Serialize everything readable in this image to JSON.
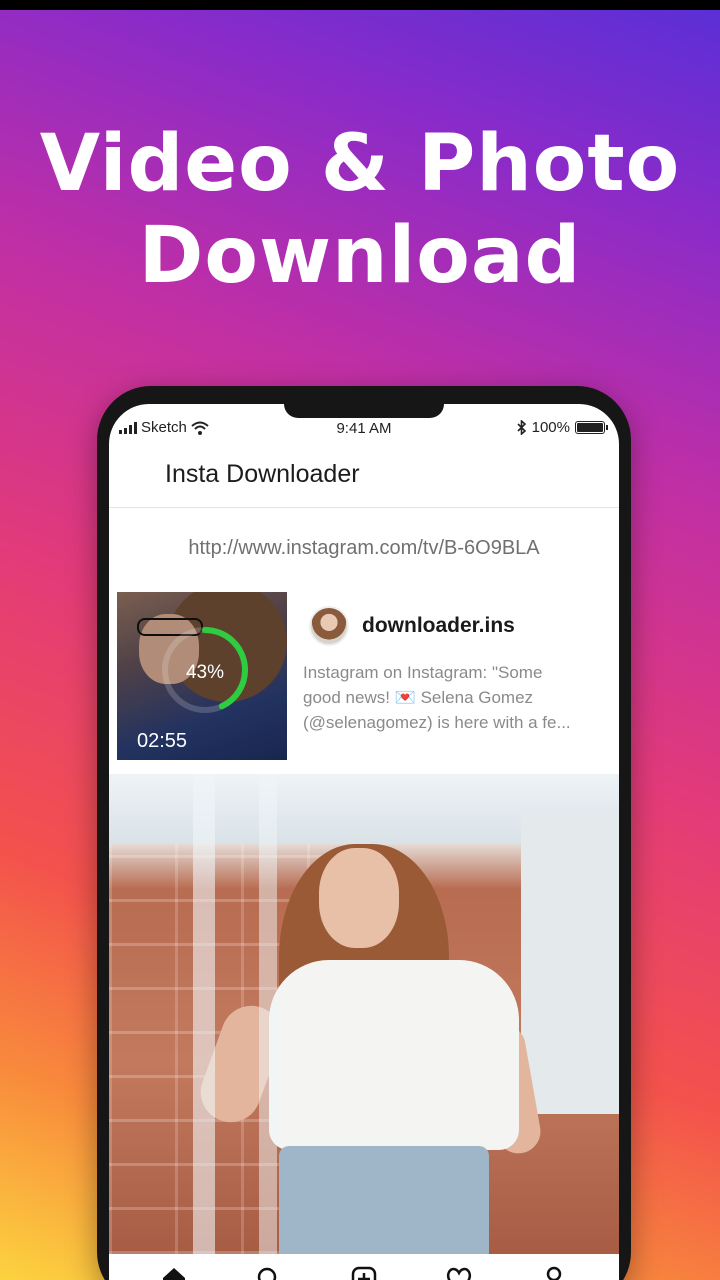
{
  "headline": {
    "line1": "Video & Photo",
    "line2": "Download"
  },
  "status_bar": {
    "carrier": "Sketch",
    "time": "9:41 AM",
    "battery": "100%"
  },
  "app": {
    "title": "Insta Downloader"
  },
  "url_input": {
    "value": "http://www.instagram.com/tv/B-6O9BLA"
  },
  "download_card": {
    "progress_percent": 43,
    "progress_label": "43%",
    "duration": "02:55",
    "username": "downloader.ins",
    "caption_line1": "Instagram on Instagram: \"Some",
    "caption_line2": "good news!",
    "caption_line2_rest": "Selena Gomez",
    "caption_line3": "(@selenagomez) is here with a fe..."
  },
  "tab_bar": {
    "tabs": [
      "home-icon",
      "search-icon",
      "add-post-icon",
      "heart-icon",
      "profile-icon"
    ]
  },
  "colors": {
    "progress_ring": "#2ecc40",
    "gradient_top": "#5b2fd6",
    "gradient_mid": "#e23a7a",
    "gradient_bottom": "#fcd33f"
  }
}
